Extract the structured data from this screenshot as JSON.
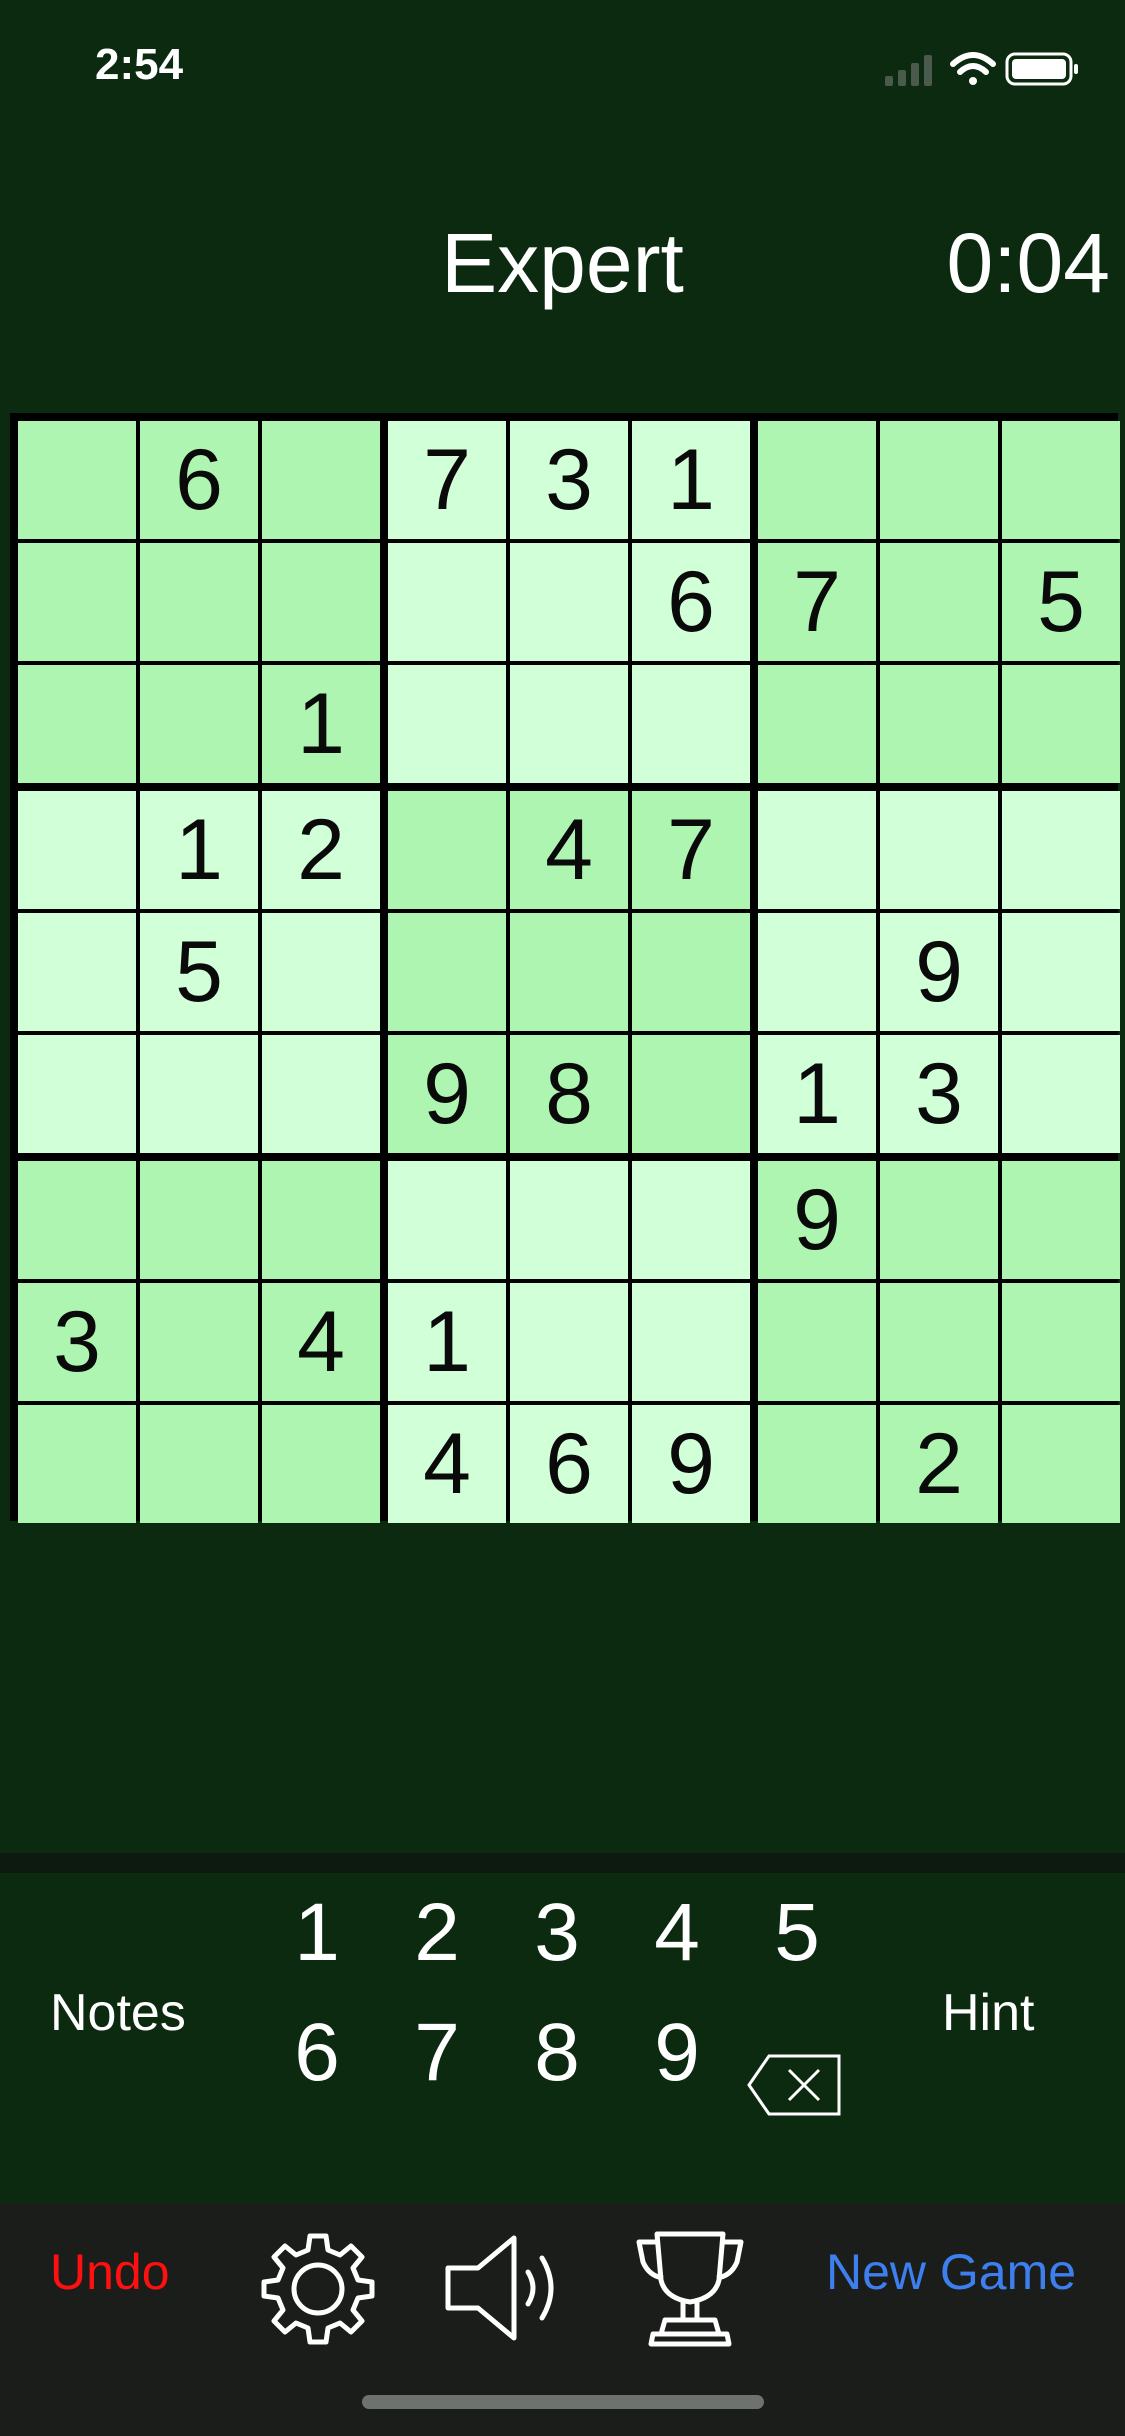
{
  "status": {
    "time": "2:54"
  },
  "header": {
    "difficulty": "Expert",
    "timer": "0:04"
  },
  "board": {
    "rows": [
      [
        "",
        "6",
        "",
        "7",
        "3",
        "1",
        "",
        "",
        ""
      ],
      [
        "",
        "",
        "",
        "",
        "",
        "6",
        "7",
        "",
        "5"
      ],
      [
        "",
        "",
        "1",
        "",
        "",
        "",
        "",
        "",
        ""
      ],
      [
        "",
        "1",
        "2",
        "",
        "4",
        "7",
        "",
        "",
        ""
      ],
      [
        "",
        "5",
        "",
        "",
        "",
        "",
        "",
        "9",
        ""
      ],
      [
        "",
        "",
        "",
        "9",
        "8",
        "",
        "1",
        "3",
        ""
      ],
      [
        "",
        "",
        "",
        "",
        "",
        "",
        "9",
        "",
        ""
      ],
      [
        "3",
        "",
        "4",
        "1",
        "",
        "",
        "",
        "",
        ""
      ],
      [
        "",
        "",
        "",
        "4",
        "6",
        "9",
        "",
        "2",
        ""
      ]
    ],
    "colors": {
      "dark_box": "#aff5b2",
      "light_box": "#d1ffd7",
      "grid": "#000000"
    }
  },
  "pad": {
    "notes_label": "Notes",
    "hint_label": "Hint",
    "numbers": [
      "1",
      "2",
      "3",
      "4",
      "5",
      "6",
      "7",
      "8",
      "9"
    ],
    "erase_icon": "backspace-icon"
  },
  "toolbar": {
    "undo_label": "Undo",
    "new_game_label": "New Game",
    "icons": [
      "gear-icon",
      "speaker-icon",
      "trophy-icon"
    ],
    "colors": {
      "undo": "#ff1010",
      "new_game": "#3e7ff0"
    }
  }
}
